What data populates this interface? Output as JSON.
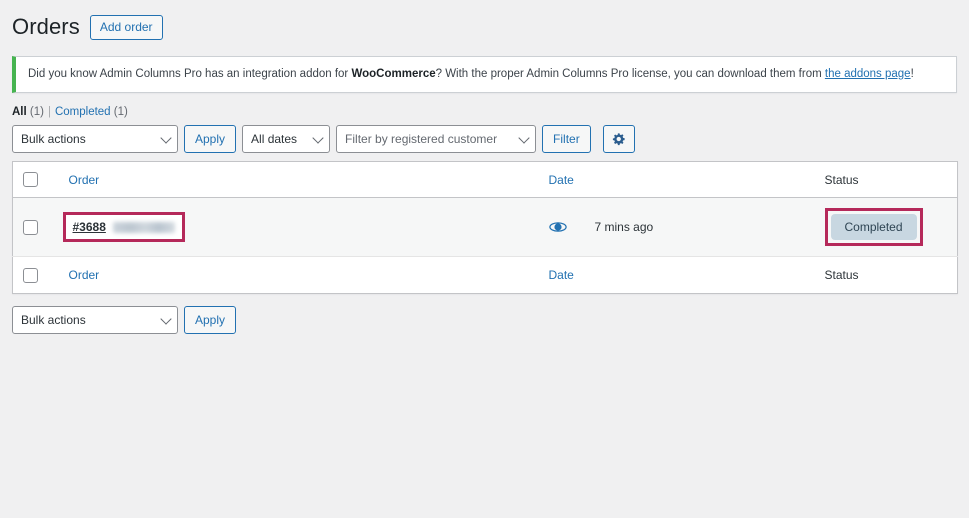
{
  "header": {
    "title": "Orders",
    "add_order_label": "Add order"
  },
  "notice": {
    "text_before": "Did you know Admin Columns Pro has an integration addon for ",
    "bold_term": "WooCommerce",
    "text_middle": "? With the proper Admin Columns Pro license, you can download them from ",
    "link_label": "the addons page",
    "text_after": "!",
    "accent_color": "#46b450"
  },
  "status_links": {
    "all_label": "All",
    "all_count": "(1)",
    "separator": "|",
    "completed_label": "Completed",
    "completed_count": "(1)"
  },
  "toolbar_top": {
    "bulk_actions_value": "Bulk actions",
    "apply_label": "Apply",
    "dates_value": "All dates",
    "customer_placeholder": "Filter by registered customer",
    "filter_label": "Filter",
    "settings_icon": "gear-icon"
  },
  "toolbar_bottom": {
    "bulk_actions_value": "Bulk actions",
    "apply_label": "Apply"
  },
  "table": {
    "columns": {
      "order": "Order",
      "date": "Date",
      "status": "Status"
    },
    "rows": [
      {
        "order_number": "#3688",
        "customer_redacted": true,
        "preview_icon": "eye-icon",
        "date": "7 mins ago",
        "status": "Completed"
      }
    ]
  },
  "highlight_color": "#b5295a",
  "accent_color": "#2271b1"
}
